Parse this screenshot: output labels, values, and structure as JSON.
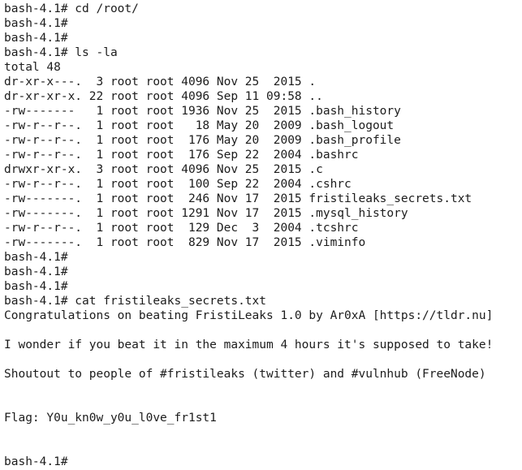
{
  "terminal": {
    "lines": [
      "bash-4.1# cd /root/",
      "bash-4.1#",
      "bash-4.1#",
      "bash-4.1# ls -la",
      "total 48",
      "dr-xr-x---.  3 root root 4096 Nov 25  2015 .",
      "dr-xr-xr-x. 22 root root 4096 Sep 11 09:58 ..",
      "-rw-------   1 root root 1936 Nov 25  2015 .bash_history",
      "-rw-r--r--.  1 root root   18 May 20  2009 .bash_logout",
      "-rw-r--r--.  1 root root  176 May 20  2009 .bash_profile",
      "-rw-r--r--.  1 root root  176 Sep 22  2004 .bashrc",
      "drwxr-xr-x.  3 root root 4096 Nov 25  2015 .c",
      "-rw-r--r--.  1 root root  100 Sep 22  2004 .cshrc",
      "-rw-------.  1 root root  246 Nov 17  2015 fristileaks_secrets.txt",
      "-rw-------.  1 root root 1291 Nov 17  2015 .mysql_history",
      "-rw-r--r--.  1 root root  129 Dec  3  2004 .tcshrc",
      "-rw-------.  1 root root  829 Nov 17  2015 .viminfo",
      "bash-4.1#",
      "bash-4.1#",
      "bash-4.1#",
      "bash-4.1# cat fristileaks_secrets.txt",
      "Congratulations on beating FristiLeaks 1.0 by Ar0xA [https://tldr.nu]",
      "",
      "I wonder if you beat it in the maximum 4 hours it's supposed to take!",
      "",
      "Shoutout to people of #fristileaks (twitter) and #vulnhub (FreeNode)",
      "",
      "",
      "Flag: Y0u_kn0w_y0u_l0ve_fr1st1",
      "",
      "",
      "bash-4.1#"
    ]
  }
}
